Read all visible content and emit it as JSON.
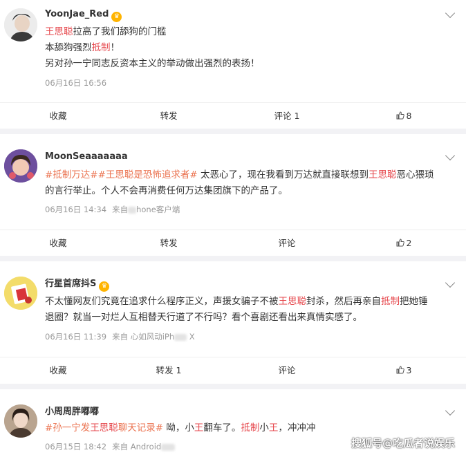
{
  "posts": [
    {
      "username": "YoonJae_Red",
      "line1_hl": "王思聪",
      "line1_rest": "拉高了我们舔狗的门槛",
      "line2_pre": "本舔狗强烈",
      "line2_hl": "抵制",
      "line2_post": "！",
      "line3": "另对孙一宁同志反资本主义的举动做出强烈的表扬！",
      "time": "06月16日 16:56",
      "actions": {
        "collect": "收藏",
        "repost": "转发",
        "comment": "评论 1",
        "like": "8"
      }
    },
    {
      "username": "MoonSeaaaaaaa",
      "tag1": "#抵制万达#",
      "tag2": "#王思聪是恐怖追求者#",
      "body_a": " 太恶心了，现在我看到万达就直接联想到",
      "hl": "王思聪",
      "body_b": "恶心猥琐",
      "body_c": "的言行举止。个人不会再消费任何万达集团旗下的产品了。",
      "time": "06月16日 14:34",
      "source_pre": "来自",
      "source_post": "hone客户端",
      "actions": {
        "collect": "收藏",
        "repost": "转发",
        "comment": "评论",
        "like": "2"
      }
    },
    {
      "username": "行星首席抖S",
      "body_a": "不太懂网友们究竟在追求什么程序正义，声援女骗子不被",
      "hl1": "王思聪",
      "body_b": "封杀，然后再亲自",
      "hl2": "抵制",
      "body_c": "把她锤",
      "body_d": "退圈？就当一对烂人互相替天行道了不行吗？看个喜剧还看出来真情实感了。",
      "time": "06月16日 11:39",
      "source_pre": "来自 心如风动iPh",
      "source_post": " X",
      "actions": {
        "collect": "收藏",
        "repost": "转发 1",
        "comment": "评论",
        "like": "3"
      }
    },
    {
      "username": "小周周胖嘟嘟",
      "tag": "#孙一宁发",
      "tag_hl": "王思聪",
      "tag_end": "聊天记录#",
      "body_a": " 呦，小",
      "hl1": "王",
      "body_b": "翻车了。",
      "hl2": "抵制",
      "body_c": "小",
      "hl3": "王",
      "body_d": "，冲冲冲",
      "time": "06月15日 18:42",
      "source_pre": "来自 Android"
    }
  ],
  "watermark": "搜狐号@吃瓜者说娱乐",
  "icons": [
    "chevron-down-icon",
    "crown-badge-icon",
    "thumb-up-icon"
  ],
  "colors": {
    "highlight": "#e6464b",
    "tag": "#eb7350",
    "meta": "#999999",
    "separator": "#f2f2f5"
  }
}
